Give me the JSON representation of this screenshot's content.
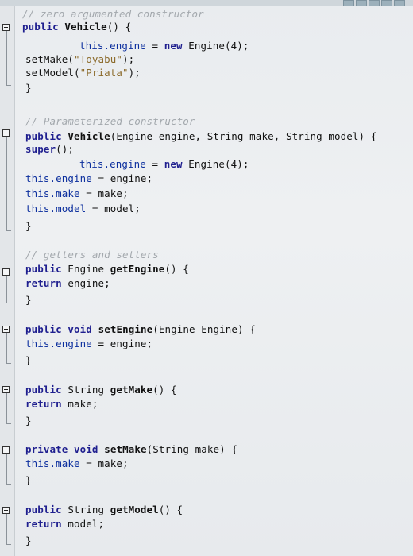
{
  "editor": {
    "lines": [
      {
        "tokens": [
          {
            "t": "cmt",
            "v": "// zero argumented constructor"
          }
        ]
      },
      {
        "tokens": [
          {
            "t": "kw",
            "v": "public"
          },
          {
            "t": "plain",
            "v": " "
          },
          {
            "t": "fn",
            "v": "Vehicle"
          },
          {
            "t": "plain",
            "v": "() {"
          }
        ]
      },
      {
        "tokens": [
          {
            "t": "field",
            "v": "this.engine"
          },
          {
            "t": "plain",
            "v": " = "
          },
          {
            "t": "new",
            "v": "new"
          },
          {
            "t": "plain",
            "v": " Engine(4);"
          }
        ]
      },
      {
        "tokens": [
          {
            "t": "plain",
            "v": "setMake("
          },
          {
            "t": "str",
            "v": "\"Toyabu\""
          },
          {
            "t": "plain",
            "v": ");"
          }
        ]
      },
      {
        "tokens": [
          {
            "t": "plain",
            "v": "setModel("
          },
          {
            "t": "str",
            "v": "\"Priata\""
          },
          {
            "t": "plain",
            "v": ");"
          }
        ]
      },
      {
        "tokens": [
          {
            "t": "brace",
            "v": "}"
          }
        ]
      },
      {
        "tokens": [
          {
            "t": "cmt",
            "v": "// Parameterized constructor"
          }
        ]
      },
      {
        "tokens": [
          {
            "t": "kw",
            "v": "public"
          },
          {
            "t": "plain",
            "v": " "
          },
          {
            "t": "fn",
            "v": "Vehicle"
          },
          {
            "t": "plain",
            "v": "(Engine engine, String make, String model) {"
          }
        ]
      },
      {
        "tokens": [
          {
            "t": "kw",
            "v": "super"
          },
          {
            "t": "plain",
            "v": "();"
          }
        ]
      },
      {
        "tokens": [
          {
            "t": "field",
            "v": "this.engine"
          },
          {
            "t": "plain",
            "v": " = "
          },
          {
            "t": "new",
            "v": "new"
          },
          {
            "t": "plain",
            "v": " Engine(4);"
          }
        ]
      },
      {
        "tokens": [
          {
            "t": "field",
            "v": "this.engine"
          },
          {
            "t": "plain",
            "v": " = engine;"
          }
        ]
      },
      {
        "tokens": [
          {
            "t": "field",
            "v": "this.make"
          },
          {
            "t": "plain",
            "v": " = make;"
          }
        ]
      },
      {
        "tokens": [
          {
            "t": "field",
            "v": "this.model"
          },
          {
            "t": "plain",
            "v": " = model;"
          }
        ]
      },
      {
        "tokens": [
          {
            "t": "brace",
            "v": "}"
          }
        ]
      },
      {
        "tokens": [
          {
            "t": "cmt",
            "v": "// getters and setters"
          }
        ]
      },
      {
        "tokens": [
          {
            "t": "kw",
            "v": "public"
          },
          {
            "t": "plain",
            "v": " Engine "
          },
          {
            "t": "fn",
            "v": "getEngine"
          },
          {
            "t": "plain",
            "v": "() {"
          }
        ]
      },
      {
        "tokens": [
          {
            "t": "kw",
            "v": "return"
          },
          {
            "t": "plain",
            "v": " engine;"
          }
        ]
      },
      {
        "tokens": [
          {
            "t": "brace",
            "v": "}"
          }
        ]
      },
      {
        "tokens": [
          {
            "t": "kw",
            "v": "public"
          },
          {
            "t": "plain",
            "v": " "
          },
          {
            "t": "kw",
            "v": "void"
          },
          {
            "t": "plain",
            "v": " "
          },
          {
            "t": "fn",
            "v": "setEngine"
          },
          {
            "t": "plain",
            "v": "(Engine Engine) {"
          }
        ]
      },
      {
        "tokens": [
          {
            "t": "field",
            "v": "this.engine"
          },
          {
            "t": "plain",
            "v": " = engine;"
          }
        ]
      },
      {
        "tokens": [
          {
            "t": "brace",
            "v": "}"
          }
        ]
      },
      {
        "tokens": [
          {
            "t": "kw",
            "v": "public"
          },
          {
            "t": "plain",
            "v": " String "
          },
          {
            "t": "fn",
            "v": "getMake"
          },
          {
            "t": "plain",
            "v": "() {"
          }
        ]
      },
      {
        "tokens": [
          {
            "t": "kw",
            "v": "return"
          },
          {
            "t": "plain",
            "v": " make;"
          }
        ]
      },
      {
        "tokens": [
          {
            "t": "brace",
            "v": "}"
          }
        ]
      },
      {
        "tokens": [
          {
            "t": "kw",
            "v": "private"
          },
          {
            "t": "plain",
            "v": " "
          },
          {
            "t": "kw",
            "v": "void"
          },
          {
            "t": "plain",
            "v": " "
          },
          {
            "t": "fn",
            "v": "setMake"
          },
          {
            "t": "plain",
            "v": "(String make) {"
          }
        ]
      },
      {
        "tokens": [
          {
            "t": "field",
            "v": "this.make"
          },
          {
            "t": "plain",
            "v": " = make;"
          }
        ]
      },
      {
        "tokens": [
          {
            "t": "brace",
            "v": "}"
          }
        ]
      },
      {
        "tokens": [
          {
            "t": "kw",
            "v": "public"
          },
          {
            "t": "plain",
            "v": " String "
          },
          {
            "t": "fn",
            "v": "getModel"
          },
          {
            "t": "plain",
            "v": "() {"
          }
        ]
      },
      {
        "tokens": [
          {
            "t": "kw",
            "v": "return"
          },
          {
            "t": "plain",
            "v": " model;"
          }
        ]
      },
      {
        "tokens": [
          {
            "t": "brace",
            "v": "}"
          }
        ]
      }
    ]
  }
}
